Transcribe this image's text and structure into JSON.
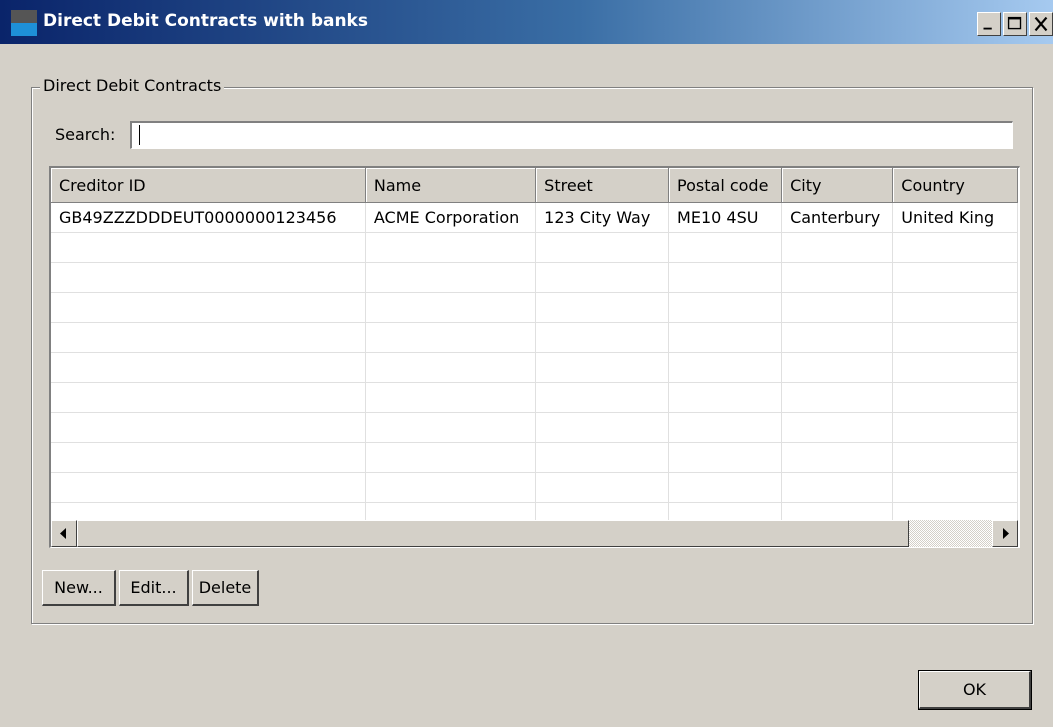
{
  "window": {
    "title": "Direct Debit Contracts with banks"
  },
  "group": {
    "title": "Direct Debit Contracts"
  },
  "search": {
    "label": "Search:",
    "value": ""
  },
  "table": {
    "columns": [
      "Creditor ID",
      "Name",
      "Street",
      "Postal code",
      "City",
      "Country"
    ],
    "rows": [
      [
        "GB49ZZZDDDEUT0000000123456",
        "ACME Corporation",
        "123 City Way",
        "ME10 4SU",
        "Canterbury",
        "United King"
      ],
      [
        "",
        "",
        "",
        "",
        "",
        ""
      ],
      [
        "",
        "",
        "",
        "",
        "",
        ""
      ],
      [
        "",
        "",
        "",
        "",
        "",
        ""
      ],
      [
        "",
        "",
        "",
        "",
        "",
        ""
      ],
      [
        "",
        "",
        "",
        "",
        "",
        ""
      ],
      [
        "",
        "",
        "",
        "",
        "",
        ""
      ],
      [
        "",
        "",
        "",
        "",
        "",
        ""
      ],
      [
        "",
        "",
        "",
        "",
        "",
        ""
      ],
      [
        "",
        "",
        "",
        "",
        "",
        ""
      ],
      [
        "",
        "",
        "",
        "",
        "",
        ""
      ]
    ]
  },
  "buttons": {
    "new": "New...",
    "edit": "Edit...",
    "delete": "Delete",
    "ok": "OK"
  },
  "icons": {
    "app": "app-icon",
    "minimize": "minimize-icon",
    "maximize": "maximize-icon",
    "close": "close-icon",
    "scroll_left": "arrow-left-icon",
    "scroll_right": "arrow-right-icon"
  }
}
